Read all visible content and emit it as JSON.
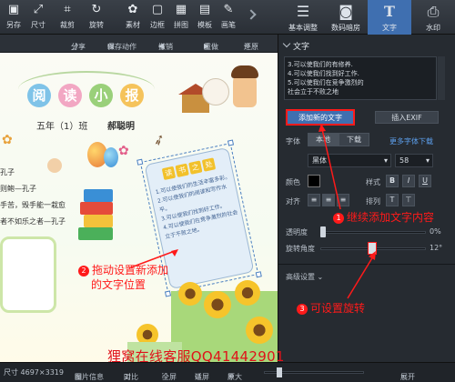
{
  "toolbar": {
    "items": [
      {
        "label": "另存",
        "icon": "save-icon",
        "glyph": "▣"
      },
      {
        "label": "尺寸",
        "icon": "resize-icon",
        "glyph": "⤢"
      },
      {
        "label": "裁剪",
        "icon": "crop-icon",
        "glyph": "⌗"
      },
      {
        "label": "旋转",
        "icon": "rotate-icon",
        "glyph": "↻"
      },
      {
        "label": "素材",
        "icon": "material-icon",
        "glyph": "✿"
      },
      {
        "label": "边框",
        "icon": "border-icon",
        "glyph": "▢"
      },
      {
        "label": "拼图",
        "icon": "collage-icon",
        "glyph": "▦"
      },
      {
        "label": "模板",
        "icon": "template-icon",
        "glyph": "▤"
      },
      {
        "label": "画笔",
        "icon": "brush-icon",
        "glyph": "✎"
      }
    ],
    "right_tabs": [
      {
        "label": "基本调整",
        "icon": "sliders-icon",
        "glyph": "☰"
      },
      {
        "label": "数码暗房",
        "icon": "camera-icon",
        "glyph": "◙"
      },
      {
        "label": "文字",
        "icon": "text-icon",
        "glyph": "T"
      },
      {
        "label": "水印",
        "icon": "stamp-icon",
        "glyph": "⎙"
      }
    ]
  },
  "subbar": {
    "share": "分享",
    "save_action": "保存动作",
    "undo": "撤销",
    "redo": "重做",
    "restore": "还原"
  },
  "canvas": {
    "title_chars": [
      "阅",
      "读",
      "小",
      "报"
    ],
    "class_line": "五年（1）班",
    "author": "郝聪明",
    "left_lines": [
      "孔子",
      "则鲍—孔子",
      "手苦，毁手能一栽愈",
      "者不如乐之者—孔子"
    ],
    "scroll_title": [
      "读",
      "书",
      "之",
      "处"
    ],
    "scroll_lines": [
      "1.可以使我们的生活丰富多彩。",
      "2.可以使我们的阅读和写作水平。",
      "3.可以使我们找到好工作。",
      "4.可以使我们在竞争激烈的社会立于不败之地。"
    ]
  },
  "panel": {
    "section_title": "文字",
    "text_lines": [
      "3.可以使我们的有修养.",
      "4.可以使我们找到好工作.",
      "5.可以使我们在竞争激烈的",
      "社会立于不败之地"
    ],
    "add_text_button": "添加新的文字",
    "insert_exif_button": "插入EXIF",
    "font_label": "字体",
    "font_tabs": [
      "本地",
      "下载"
    ],
    "more_fonts_link": "更多字体下载",
    "font_value": "黑体",
    "size_value": "58",
    "color_label": "颜色",
    "style_label": "样式",
    "style_buttons": [
      "B",
      "I",
      "U"
    ],
    "align_label": "对齐",
    "arrange_label": "排列",
    "opacity_label": "透明度",
    "opacity_value": "0%",
    "rotation_label": "旋转角度",
    "rotation_value": "12°",
    "advanced_label": "高级设置"
  },
  "callouts": {
    "c1": {
      "num": "1",
      "text": "继续添加文字内容"
    },
    "c2": {
      "num": "2",
      "text_line1": "拖动设置新添加",
      "text_line2": "的文字位置"
    },
    "c3": {
      "num": "3",
      "text": "可设置旋转"
    }
  },
  "watermark": "狸窝在线客服QQ41442901",
  "status": {
    "size": "尺寸 4697×3319",
    "image_info": "图片信息",
    "compare": "对比",
    "fullscreen": "全屏",
    "fit": "适屏",
    "original": "原大",
    "expand": "展开"
  },
  "colors": {
    "accent": "#3f6fb0",
    "callout": "#ff1a1a",
    "panel": "#262b31"
  }
}
